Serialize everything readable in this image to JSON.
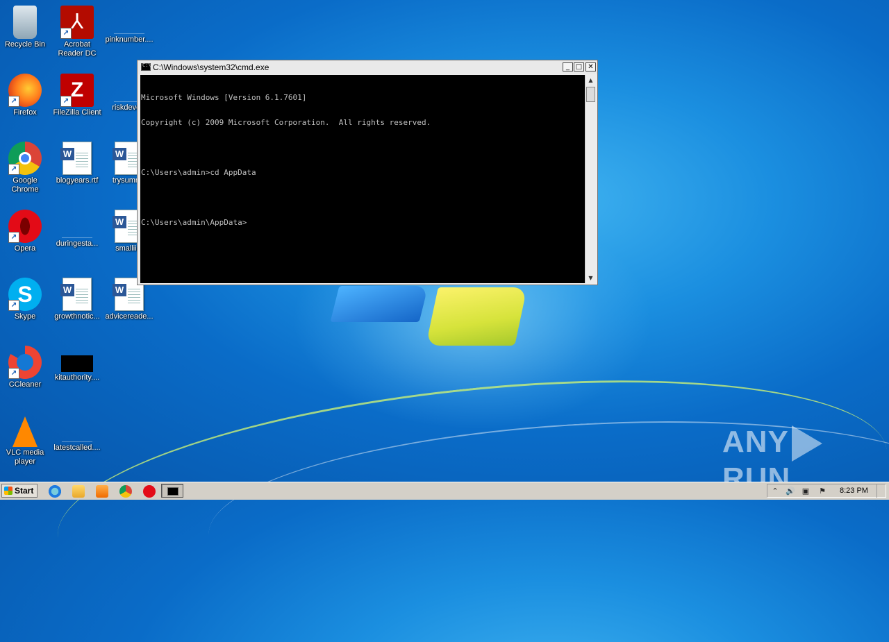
{
  "desktop": {
    "icons": [
      {
        "label": "Recycle Bin",
        "icon": "recycle-bin-icon"
      },
      {
        "label": "Acrobat Reader DC",
        "icon": "acrobat-reader-icon"
      },
      {
        "label": "pinknumber....",
        "icon": "blank-file-icon"
      },
      {
        "label": "Firefox",
        "icon": "firefox-icon"
      },
      {
        "label": "FileZilla Client",
        "icon": "filezilla-icon"
      },
      {
        "label": "riskdevelo",
        "icon": "blank-file-icon"
      },
      {
        "label": "Google Chrome",
        "icon": "chrome-icon"
      },
      {
        "label": "blogyears.rtf",
        "icon": "word-document-icon"
      },
      {
        "label": "trysumma",
        "icon": "word-document-icon"
      },
      {
        "label": "Opera",
        "icon": "opera-icon"
      },
      {
        "label": "duringesta...",
        "icon": "blank-file-icon"
      },
      {
        "label": "smallii...",
        "icon": "word-document-icon"
      },
      {
        "label": "Skype",
        "icon": "skype-icon"
      },
      {
        "label": "growthnotic...",
        "icon": "word-document-icon"
      },
      {
        "label": "advicereade...",
        "icon": "word-document-icon"
      },
      {
        "label": "CCleaner",
        "icon": "ccleaner-icon"
      },
      {
        "label": "kitauthority....",
        "icon": "black-image-file-icon"
      },
      {
        "label": "VLC media player",
        "icon": "vlc-icon"
      },
      {
        "label": "latestcalled....",
        "icon": "blank-file-icon"
      }
    ]
  },
  "cmd_window": {
    "title": "C:\\Windows\\system32\\cmd.exe",
    "buttons": {
      "minimize": "_",
      "maximize": "□",
      "close": "✕"
    },
    "lines": [
      "Microsoft Windows [Version 6.1.7601]",
      "Copyright (c) 2009 Microsoft Corporation.  All rights reserved.",
      "",
      "C:\\Users\\admin>cd AppData",
      "",
      "C:\\Users\\admin\\AppData>"
    ],
    "scroll_up": "▲",
    "scroll_down": "▼"
  },
  "taskbar": {
    "start_label": "Start",
    "quick_launch": [
      "internet-explorer-icon",
      "windows-explorer-icon",
      "media-player-icon",
      "chrome-icon",
      "opera-icon"
    ],
    "active_task": "cmd-icon",
    "tray": {
      "show_hidden": "⌃",
      "volume": "🔊",
      "network": "▣",
      "flag": "⚑",
      "clock": "8:23 PM"
    }
  },
  "watermark": {
    "left": "ANY",
    "right": "RUN"
  }
}
